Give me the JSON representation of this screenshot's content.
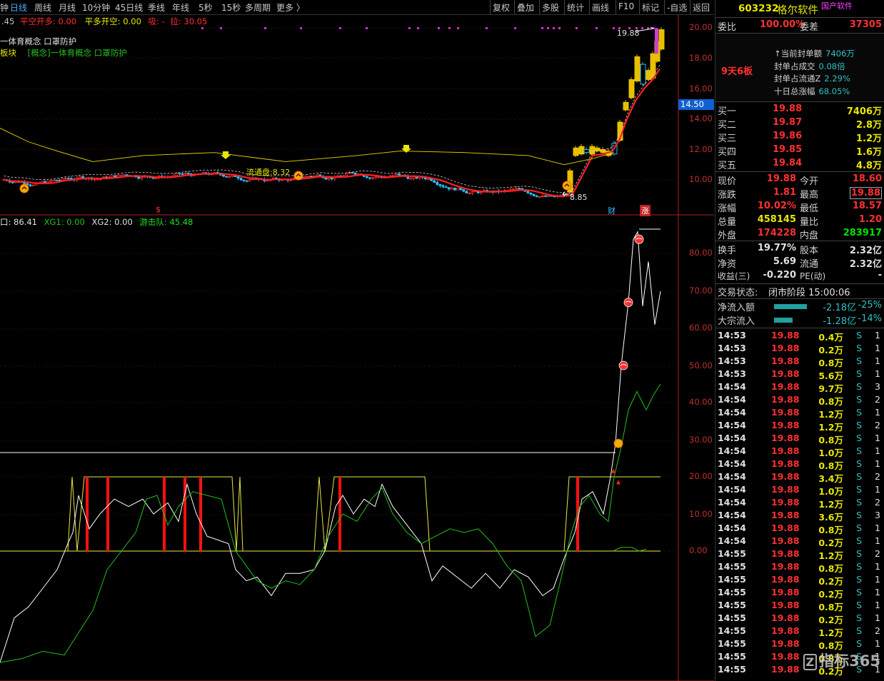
{
  "toolbar": {
    "left_items": [
      "钟",
      "日线",
      "周线",
      "月线",
      "10分钟",
      "45日线",
      "季线",
      "年线",
      "5秒",
      "15秒",
      "多周期",
      "更多 〉"
    ],
    "right_items": [
      "复权",
      "叠加",
      "多股",
      "统计",
      "画线",
      "F10",
      "标记",
      "-自选",
      "返回"
    ]
  },
  "indicator_line1": {
    "prefix": ".45",
    "pk": "平空开多: 0.00",
    "pd": "平多开空: 0.00",
    "xi": "吸: -",
    "la": "拉: 30.05"
  },
  "concept_line1": "一体育概念 口罩防护",
  "concept_line2_a": "板块",
  "concept_line2_b": "[概念]一体育概念 口罩防护",
  "price_axis": [
    "20.00",
    "18.00",
    "16.00",
    "14.00",
    "12.00",
    "10.00"
  ],
  "price_marker": "14.50",
  "annotations": {
    "high": "19.88",
    "low": "8.85",
    "seal": "流通盘:8.32",
    "cai": "财",
    "jiang": "涨",
    "s_mark": "$"
  },
  "osc_header": {
    "kou": "口: 86.41",
    "xg1": "XG1: 0.00",
    "xg2": "XG2: 0.00",
    "yjd": "游击队: 45.48"
  },
  "osc_axis": [
    "80.00",
    "70.00",
    "60.00",
    "50.00",
    "40.00",
    "30.00",
    "20.00",
    "10.00",
    "0.00"
  ],
  "quote": {
    "code": "603232",
    "name": "格尔软件",
    "tag": "国产软件",
    "wb_label": "委比",
    "wb_val": "100.00%",
    "wc_label": "委差",
    "wc_val": "37305",
    "limit_text": "9天6板",
    "seal_lines": [
      {
        "label": "当前封单额",
        "value": "7406万"
      },
      {
        "label": "封单占成交",
        "value": "0.08倍"
      },
      {
        "label": "封单占流通Z",
        "value": "2.29%"
      },
      {
        "label": "十日总涨幅",
        "value": "68.05%"
      }
    ],
    "bids": [
      {
        "label": "买一",
        "price": "19.88",
        "vol": "7406万"
      },
      {
        "label": "买二",
        "price": "19.87",
        "vol": "2.8万"
      },
      {
        "label": "买三",
        "price": "19.86",
        "vol": "1.2万"
      },
      {
        "label": "买四",
        "price": "19.85",
        "vol": "1.6万"
      },
      {
        "label": "买五",
        "price": "19.84",
        "vol": "4.8万"
      }
    ],
    "stats": [
      {
        "l1": "现价",
        "v1": "19.88",
        "l2": "今开",
        "v2": "18.60",
        "c1": "red",
        "c2": "red"
      },
      {
        "l1": "涨跌",
        "v1": "1.81",
        "l2": "最高",
        "v2": "19.88",
        "c1": "red",
        "c2": "red"
      },
      {
        "l1": "涨幅",
        "v1": "10.02%",
        "l2": "最低",
        "v2": "18.57",
        "c1": "red",
        "c2": "red"
      },
      {
        "l1": "总量",
        "v1": "458145",
        "l2": "量比",
        "v2": "1.20",
        "c1": "yellow",
        "c2": "red"
      },
      {
        "l1": "外盘",
        "v1": "174228",
        "l2": "内盘",
        "v2": "283917",
        "c1": "red",
        "c2": "green"
      },
      {
        "l1": "换手",
        "v1": "19.77%",
        "l2": "股本",
        "v2": "2.32亿",
        "c1": "white",
        "c2": "white"
      },
      {
        "l1": "净资",
        "v1": "5.69",
        "l2": "流通",
        "v2": "2.32亿",
        "c1": "white",
        "c2": "white"
      },
      {
        "l1": "收益(三)",
        "v1": "-0.220",
        "l2": "PE(动)",
        "v2": "-",
        "c1": "white",
        "c2": "white"
      }
    ],
    "trade_status_label": "交易状态:",
    "trade_status": "闭市阶段 15:00:06",
    "flow": [
      {
        "label": "净流入额",
        "value": "-2.18亿",
        "pct": "-25%"
      },
      {
        "label": "大宗流入",
        "value": "-1.28亿",
        "pct": "-14%"
      }
    ],
    "ticks": [
      [
        "14:53",
        "19.88",
        "0.4万",
        "S",
        "1"
      ],
      [
        "14:53",
        "19.88",
        "0.2万",
        "S",
        "1"
      ],
      [
        "14:53",
        "19.88",
        "0.8万",
        "S",
        "1"
      ],
      [
        "14:53",
        "19.88",
        "5.6万",
        "S",
        "1"
      ],
      [
        "14:54",
        "19.88",
        "9.7万",
        "S",
        "3"
      ],
      [
        "14:54",
        "19.88",
        "0.8万",
        "S",
        "2"
      ],
      [
        "14:54",
        "19.88",
        "1.2万",
        "S",
        "1"
      ],
      [
        "14:54",
        "19.88",
        "1.2万",
        "S",
        "2"
      ],
      [
        "14:54",
        "19.88",
        "0.8万",
        "S",
        "1"
      ],
      [
        "14:54",
        "19.88",
        "1.0万",
        "S",
        "1"
      ],
      [
        "14:54",
        "19.88",
        "0.8万",
        "S",
        "1"
      ],
      [
        "14:54",
        "19.88",
        "3.4万",
        "S",
        "2"
      ],
      [
        "14:54",
        "19.88",
        "1.0万",
        "S",
        "1"
      ],
      [
        "14:54",
        "19.88",
        "1.2万",
        "S",
        "2"
      ],
      [
        "14:54",
        "19.88",
        "3.6万",
        "S",
        "3"
      ],
      [
        "14:54",
        "19.88",
        "0.8万",
        "S",
        "1"
      ],
      [
        "14:54",
        "19.88",
        "0.2万",
        "S",
        "1"
      ],
      [
        "14:55",
        "19.88",
        "1.2万",
        "S",
        "2"
      ],
      [
        "14:55",
        "19.88",
        "0.8万",
        "S",
        "1"
      ],
      [
        "14:55",
        "19.88",
        "0.2万",
        "S",
        "1"
      ],
      [
        "14:55",
        "19.88",
        "0.2万",
        "S",
        "1"
      ],
      [
        "14:55",
        "19.88",
        "0.8万",
        "S",
        "1"
      ],
      [
        "14:55",
        "19.88",
        "0.2万",
        "S",
        "1"
      ],
      [
        "14:55",
        "19.88",
        "1.2万",
        "S",
        "2"
      ],
      [
        "14:55",
        "19.88",
        "0.8万",
        "S",
        "1"
      ],
      [
        "14:55",
        "19.88",
        "0.8万",
        "S",
        "1"
      ],
      [
        "14:55",
        "19.88",
        "0.2万",
        "S",
        "1"
      ]
    ],
    "watermark": "指标365"
  },
  "colors": {
    "up": "#ff3030",
    "down": "#30c0ff",
    "ma": "#ff2020",
    "bg": "#000000",
    "osc_white": "#ffffff",
    "osc_green": "#20c020",
    "osc_yellow": "#e8e840"
  }
}
